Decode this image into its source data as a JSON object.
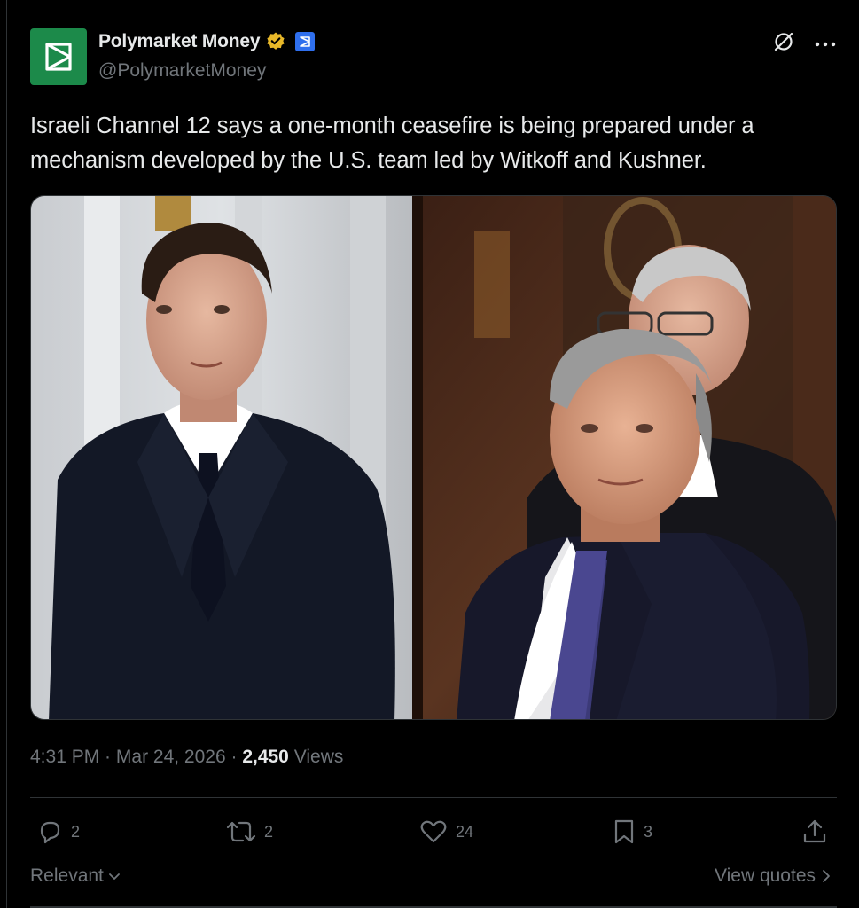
{
  "author": {
    "display_name": "Polymarket Money",
    "handle": "@PolymarketMoney",
    "avatar_color": "#1c8a4a",
    "verified_badge_color": "#e8b829",
    "affiliate_badge_color": "#2f6fed"
  },
  "header_icons": [
    "grok-slash-icon",
    "more-options-icon"
  ],
  "post": {
    "text": "Israeli Channel 12 says a one-month ceasefire is being prepared under a mechanism developed by the U.S. team led by Witkoff and Kushner."
  },
  "meta": {
    "time": "4:31 PM",
    "date": "Mar 24, 2026",
    "views_count": "2,450",
    "views_label": "Views",
    "separator": " · "
  },
  "actions": {
    "replies": "2",
    "reposts": "2",
    "likes": "24",
    "bookmarks": "3"
  },
  "footer": {
    "sort_label": "Relevant",
    "quotes_label": "View quotes"
  },
  "colors": {
    "background": "#000000",
    "text": "#e7e9ea",
    "muted": "#71767b",
    "border": "#2f3336"
  }
}
